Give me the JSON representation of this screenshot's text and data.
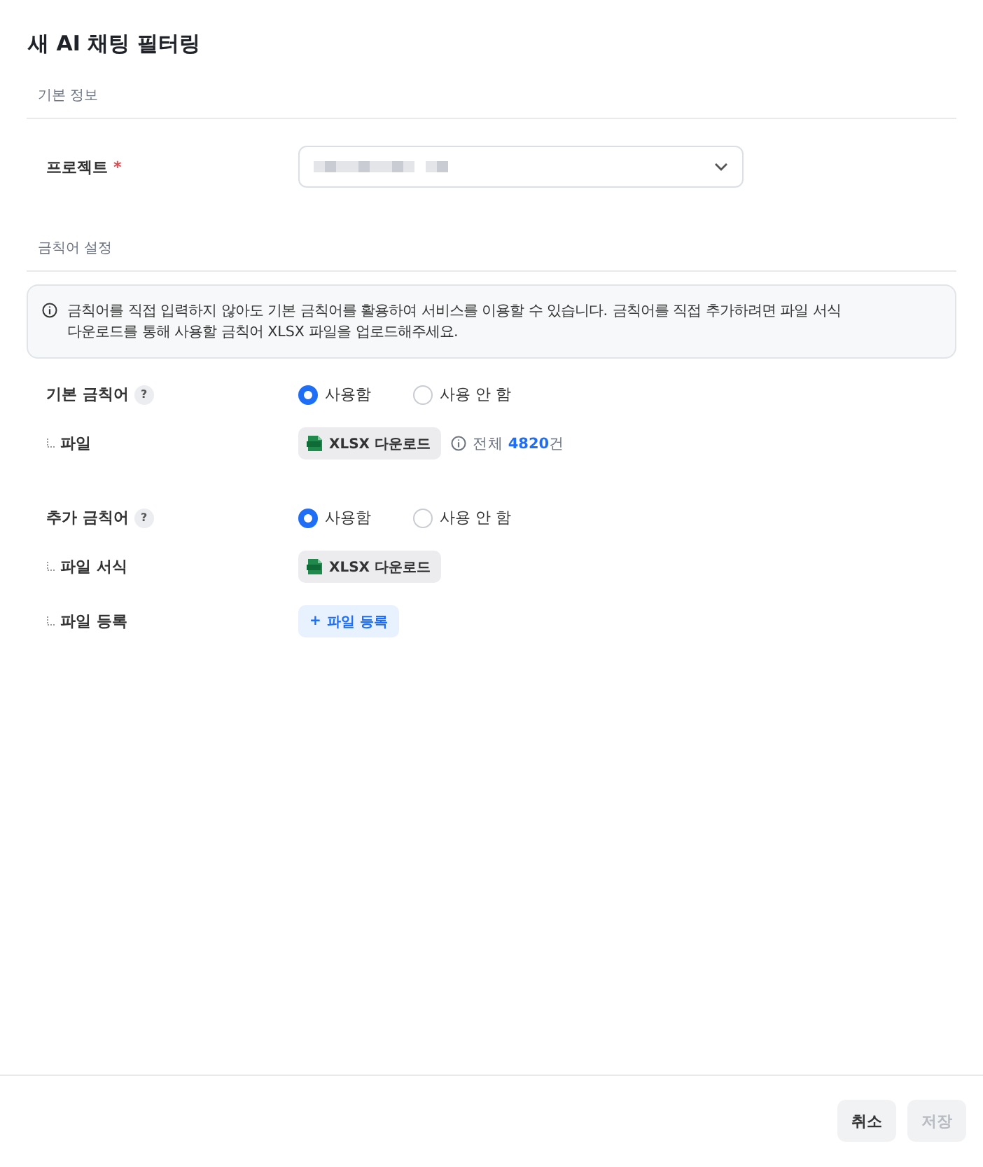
{
  "title": "새 AI 채팅 필터링",
  "basic_info": {
    "heading": "기본 정보",
    "project": {
      "label": "프로젝트",
      "required_mark": "*"
    }
  },
  "forbidden_words": {
    "heading": "금칙어 설정",
    "notice": "금칙어를 직접 입력하지 않아도 기본 금칙어를 활용하여 서비스를 이용할 수 있습니다. 금칙어를 직접 추가하려면 파일 서식 다운로드를 통해 사용할 금칙어 XLSX 파일을 업로드해주세요.",
    "groups": [
      {
        "label": "기본 금칙어",
        "help": "?",
        "options": [
          {
            "label": "사용함",
            "selected": true
          },
          {
            "label": "사용 안 함",
            "selected": false
          }
        ],
        "rows": [
          {
            "label": "파일",
            "kind": "download",
            "button": "XLSX 다운로드",
            "total_label": "전체",
            "total_count": "4820",
            "total_unit": "건"
          }
        ]
      },
      {
        "label": "추가 금칙어",
        "help": "?",
        "options": [
          {
            "label": "사용함",
            "selected": true
          },
          {
            "label": "사용 안 함",
            "selected": false
          }
        ],
        "rows": [
          {
            "label": "파일 서식",
            "kind": "download",
            "button": "XLSX 다운로드"
          },
          {
            "label": "파일 등록",
            "kind": "upload",
            "button": "파일 등록",
            "button_icon": "+"
          }
        ]
      }
    ]
  },
  "footer": {
    "buttons": [
      {
        "label": "취소",
        "disabled": false
      },
      {
        "label": "저장",
        "disabled": true
      }
    ]
  }
}
